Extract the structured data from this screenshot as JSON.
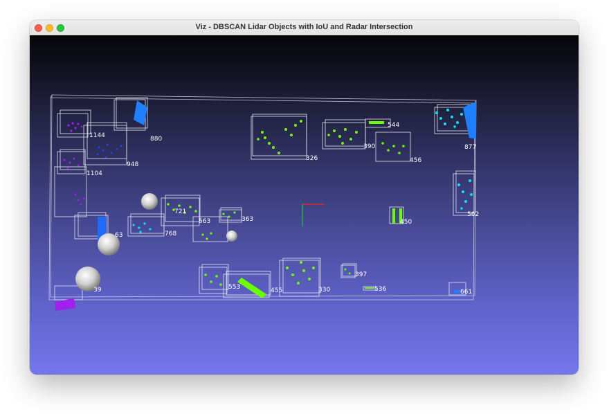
{
  "window": {
    "title": "Viz - DBSCAN Lidar Objects with IoU and Radar Intersection"
  },
  "labels": [
    "1144",
    "880",
    "948",
    "1104",
    "326",
    "390",
    "544",
    "456",
    "877",
    "562",
    "450",
    "721",
    "563",
    "363",
    "768",
    "63",
    "39",
    "553",
    "455",
    "330",
    "397",
    "536",
    "661"
  ]
}
